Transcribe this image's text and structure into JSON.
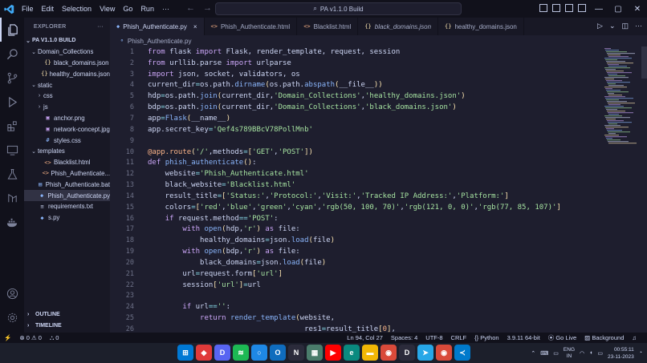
{
  "menu": [
    "File",
    "Edit",
    "Selection",
    "View",
    "Go",
    "Run",
    "···"
  ],
  "command_center": "PA v1.1.0 Build",
  "explorer": {
    "title": "EXPLORER",
    "root": "PA V1.1.0 BUILD",
    "tree": [
      {
        "label": "Domain_Collections",
        "type": "folder-open",
        "depth": 1
      },
      {
        "label": "black_domains.json",
        "type": "json",
        "depth": 2
      },
      {
        "label": "healthy_domains.json",
        "type": "json",
        "depth": 2
      },
      {
        "label": "static",
        "type": "folder-open",
        "depth": 1
      },
      {
        "label": "css",
        "type": "folder-closed",
        "depth": 2
      },
      {
        "label": "js",
        "type": "folder-closed",
        "depth": 2
      },
      {
        "label": "anchor.png",
        "type": "image",
        "depth": 2
      },
      {
        "label": "network-concept.jpg",
        "type": "image",
        "depth": 2
      },
      {
        "label": "styles.css",
        "type": "css",
        "depth": 2
      },
      {
        "label": "templates",
        "type": "folder-open",
        "depth": 1
      },
      {
        "label": "Blacklist.html",
        "type": "html",
        "depth": 2
      },
      {
        "label": "Phish_Authenticate...",
        "type": "html",
        "depth": 2
      },
      {
        "label": "Phish_Authenticate.bat",
        "type": "bat",
        "depth": 1
      },
      {
        "label": "Phish_Authenticate.py",
        "type": "py",
        "depth": 1,
        "selected": true
      },
      {
        "label": "requirements.txt",
        "type": "txt",
        "depth": 1
      },
      {
        "label": "s.py",
        "type": "py",
        "depth": 1
      }
    ],
    "outline": "OUTLINE",
    "timeline": "TIMELINE"
  },
  "tabs": [
    {
      "label": "Phish_Authenticate.py",
      "icon": "py",
      "active": true,
      "close": "×"
    },
    {
      "label": "Phish_Authenticate.html",
      "icon": "html"
    },
    {
      "label": "Blacklist.html",
      "icon": "html"
    },
    {
      "label": "black_domains.json",
      "icon": "json",
      "italic": true
    },
    {
      "label": "healthy_domains.json",
      "icon": "json"
    }
  ],
  "breadcrumb": "Phish_Authenticate.py",
  "code_lines": [
    [
      [
        "kw",
        "from"
      ],
      [
        "var",
        " flask "
      ],
      [
        "kw",
        "import"
      ],
      [
        "var",
        " Flask, render_template, request, session"
      ]
    ],
    [
      [
        "kw",
        "from"
      ],
      [
        "var",
        " urllib.parse "
      ],
      [
        "kw",
        "import"
      ],
      [
        "var",
        " urlparse"
      ]
    ],
    [
      [
        "kw",
        "import"
      ],
      [
        "var",
        " json, socket, validators, os"
      ]
    ],
    [
      [
        "var",
        "current_dir"
      ],
      [
        "op",
        "="
      ],
      [
        "var",
        "os.path."
      ],
      [
        "fn",
        "dirname"
      ],
      [
        "pm",
        "("
      ],
      [
        "var",
        "os.path."
      ],
      [
        "fn",
        "abspath"
      ],
      [
        "pm",
        "("
      ],
      [
        "var",
        "__file__"
      ],
      [
        "pm",
        "))"
      ]
    ],
    [
      [
        "var",
        "hdp"
      ],
      [
        "op",
        "="
      ],
      [
        "var",
        "os.path."
      ],
      [
        "fn",
        "join"
      ],
      [
        "pm",
        "("
      ],
      [
        "var",
        "current_dir,"
      ],
      [
        "str",
        "'Domain_Collections'"
      ],
      [
        "var",
        ","
      ],
      [
        "str",
        "'healthy_domains.json'"
      ],
      [
        "pm",
        ")"
      ]
    ],
    [
      [
        "var",
        "bdp"
      ],
      [
        "op",
        "="
      ],
      [
        "var",
        "os.path."
      ],
      [
        "fn",
        "join"
      ],
      [
        "pm",
        "("
      ],
      [
        "var",
        "current_dir,"
      ],
      [
        "str",
        "'Domain_Collections'"
      ],
      [
        "var",
        ","
      ],
      [
        "str",
        "'black_domains.json'"
      ],
      [
        "pm",
        ")"
      ]
    ],
    [
      [
        "var",
        "app"
      ],
      [
        "op",
        "="
      ],
      [
        "fn",
        "Flask"
      ],
      [
        "pm",
        "("
      ],
      [
        "var",
        "__name__"
      ],
      [
        "pm",
        ")"
      ]
    ],
    [
      [
        "var",
        "app.secret_key"
      ],
      [
        "op",
        "="
      ],
      [
        "str",
        "'Qef4s789BBcV78PollMnb'"
      ]
    ],
    [
      [
        "var",
        ""
      ]
    ],
    [
      [
        "dec",
        "@app.route"
      ],
      [
        "pm",
        "("
      ],
      [
        "str",
        "'/'"
      ],
      [
        "var",
        ","
      ],
      [
        "var",
        "methods"
      ],
      [
        "op",
        "="
      ],
      [
        "pm",
        "["
      ],
      [
        "str",
        "'GET'"
      ],
      [
        "var",
        ","
      ],
      [
        "str",
        "'POST'"
      ],
      [
        "pm",
        "])"
      ]
    ],
    [
      [
        "kw",
        "def"
      ],
      [
        "var",
        " "
      ],
      [
        "fn",
        "phish_authenticate"
      ],
      [
        "pm",
        "()"
      ],
      [
        "var",
        ":"
      ]
    ],
    [
      [
        "var",
        "    website"
      ],
      [
        "op",
        "="
      ],
      [
        "str",
        "'Phish_Authenticate.html'"
      ]
    ],
    [
      [
        "var",
        "    black_website"
      ],
      [
        "op",
        "="
      ],
      [
        "str",
        "'Blacklist.html'"
      ]
    ],
    [
      [
        "var",
        "    result_title"
      ],
      [
        "op",
        "="
      ],
      [
        "pm",
        "["
      ],
      [
        "str",
        "'Status:'"
      ],
      [
        "var",
        ","
      ],
      [
        "str",
        "'Protocol:'"
      ],
      [
        "var",
        ","
      ],
      [
        "str",
        "'Visit:'"
      ],
      [
        "var",
        ","
      ],
      [
        "str",
        "'Tracked IP Address:'"
      ],
      [
        "var",
        ","
      ],
      [
        "str",
        "'Platform:'"
      ],
      [
        "pm",
        "]"
      ]
    ],
    [
      [
        "var",
        "    colors"
      ],
      [
        "op",
        "="
      ],
      [
        "pm",
        "["
      ],
      [
        "str",
        "'red'"
      ],
      [
        "var",
        ","
      ],
      [
        "str",
        "'blue'"
      ],
      [
        "var",
        ","
      ],
      [
        "str",
        "'green'"
      ],
      [
        "var",
        ","
      ],
      [
        "str",
        "'cyan'"
      ],
      [
        "var",
        ","
      ],
      [
        "str",
        "'rgb(50, 100, 70)'"
      ],
      [
        "var",
        ","
      ],
      [
        "str",
        "'rgb(121, 0, 0)'"
      ],
      [
        "var",
        ","
      ],
      [
        "str",
        "'rgb(77, 85, 107)'"
      ],
      [
        "pm",
        "]"
      ]
    ],
    [
      [
        "var",
        "    "
      ],
      [
        "kw",
        "if"
      ],
      [
        "var",
        " request.method"
      ],
      [
        "op",
        "=="
      ],
      [
        "str",
        "'POST'"
      ],
      [
        "var",
        ":"
      ]
    ],
    [
      [
        "var",
        "        "
      ],
      [
        "kw",
        "with"
      ],
      [
        "var",
        " "
      ],
      [
        "fn",
        "open"
      ],
      [
        "pm",
        "("
      ],
      [
        "var",
        "hdp,"
      ],
      [
        "str",
        "'r'"
      ],
      [
        "pm",
        ")"
      ],
      [
        "var",
        " "
      ],
      [
        "kw",
        "as"
      ],
      [
        "var",
        " file:"
      ]
    ],
    [
      [
        "var",
        "            healthy_domains"
      ],
      [
        "op",
        "="
      ],
      [
        "var",
        "json."
      ],
      [
        "fn",
        "load"
      ],
      [
        "pm",
        "("
      ],
      [
        "var",
        "file"
      ],
      [
        "pm",
        ")"
      ]
    ],
    [
      [
        "var",
        "        "
      ],
      [
        "kw",
        "with"
      ],
      [
        "var",
        " "
      ],
      [
        "fn",
        "open"
      ],
      [
        "pm",
        "("
      ],
      [
        "var",
        "bdp,"
      ],
      [
        "str",
        "'r'"
      ],
      [
        "pm",
        ")"
      ],
      [
        "var",
        " "
      ],
      [
        "kw",
        "as"
      ],
      [
        "var",
        " file:"
      ]
    ],
    [
      [
        "var",
        "            black_domains"
      ],
      [
        "op",
        "="
      ],
      [
        "var",
        "json."
      ],
      [
        "fn",
        "load"
      ],
      [
        "pm",
        "("
      ],
      [
        "var",
        "file"
      ],
      [
        "pm",
        ")"
      ]
    ],
    [
      [
        "var",
        "        url"
      ],
      [
        "op",
        "="
      ],
      [
        "var",
        "request.form"
      ],
      [
        "pm",
        "["
      ],
      [
        "str",
        "'url'"
      ],
      [
        "pm",
        "]"
      ]
    ],
    [
      [
        "var",
        "        session"
      ],
      [
        "pm",
        "["
      ],
      [
        "str",
        "'url'"
      ],
      [
        "pm",
        "]"
      ],
      [
        "op",
        "="
      ],
      [
        "var",
        "url"
      ]
    ],
    [
      [
        "var",
        ""
      ]
    ],
    [
      [
        "var",
        "        "
      ],
      [
        "kw",
        "if"
      ],
      [
        "var",
        " url"
      ],
      [
        "op",
        "=="
      ],
      [
        "str",
        "''"
      ],
      [
        "var",
        ":"
      ]
    ],
    [
      [
        "var",
        "            "
      ],
      [
        "kw",
        "return"
      ],
      [
        "var",
        " "
      ],
      [
        "fn",
        "render_template"
      ],
      [
        "pm",
        "("
      ],
      [
        "var",
        "website,"
      ]
    ],
    [
      [
        "var",
        "                                    res1"
      ],
      [
        "op",
        "="
      ],
      [
        "var",
        "result_title"
      ],
      [
        "pm",
        "["
      ],
      [
        "num",
        "0"
      ],
      [
        "pm",
        "]"
      ],
      [
        "var",
        ","
      ]
    ]
  ],
  "status_bar": {
    "left": [
      "⚡",
      "⊗ 0 ⚠ 0",
      "⛬ 0"
    ],
    "cursor": "Ln 94, Col 27",
    "spaces": "Spaces: 4",
    "encoding": "UTF-8",
    "eol": "CRLF",
    "language": "Python",
    "interpreter": "3.9.11 64-bit",
    "golive": "Go Live",
    "background": "Background"
  },
  "taskbar": {
    "apps": [
      {
        "name": "windows-start",
        "color": "#0078d4",
        "glyph": "⊞"
      },
      {
        "name": "app-red",
        "color": "#e03a3a",
        "glyph": "◆"
      },
      {
        "name": "discord",
        "color": "#5865f2",
        "glyph": "D"
      },
      {
        "name": "spotify",
        "color": "#1db954",
        "glyph": "≋"
      },
      {
        "name": "cortana",
        "color": "#1e88e5",
        "glyph": "○"
      },
      {
        "name": "outlook",
        "color": "#0f6cbd",
        "glyph": "O"
      },
      {
        "name": "app-nc",
        "color": "#2b2b3b",
        "glyph": "N"
      },
      {
        "name": "app-grid",
        "color": "#4a7c6b",
        "glyph": "▦"
      },
      {
        "name": "youtube",
        "color": "#ff0000",
        "glyph": "▶"
      },
      {
        "name": "edge",
        "color": "#0a8a7f",
        "glyph": "e"
      },
      {
        "name": "file-explorer",
        "color": "#f2b705",
        "glyph": "▬"
      },
      {
        "name": "chrome",
        "color": "#d94a3a",
        "glyph": "◉"
      },
      {
        "name": "app-d",
        "color": "#2b2b3b",
        "glyph": "D"
      },
      {
        "name": "telegram",
        "color": "#27a7e7",
        "glyph": "➤"
      },
      {
        "name": "chrome-2",
        "color": "#d94a3a",
        "glyph": "◉"
      },
      {
        "name": "vscode",
        "color": "#007acc",
        "glyph": "≺"
      }
    ],
    "lang_top": "ENG",
    "lang_bottom": "IN",
    "time": "00:55:11",
    "date": "23-11-2023"
  }
}
